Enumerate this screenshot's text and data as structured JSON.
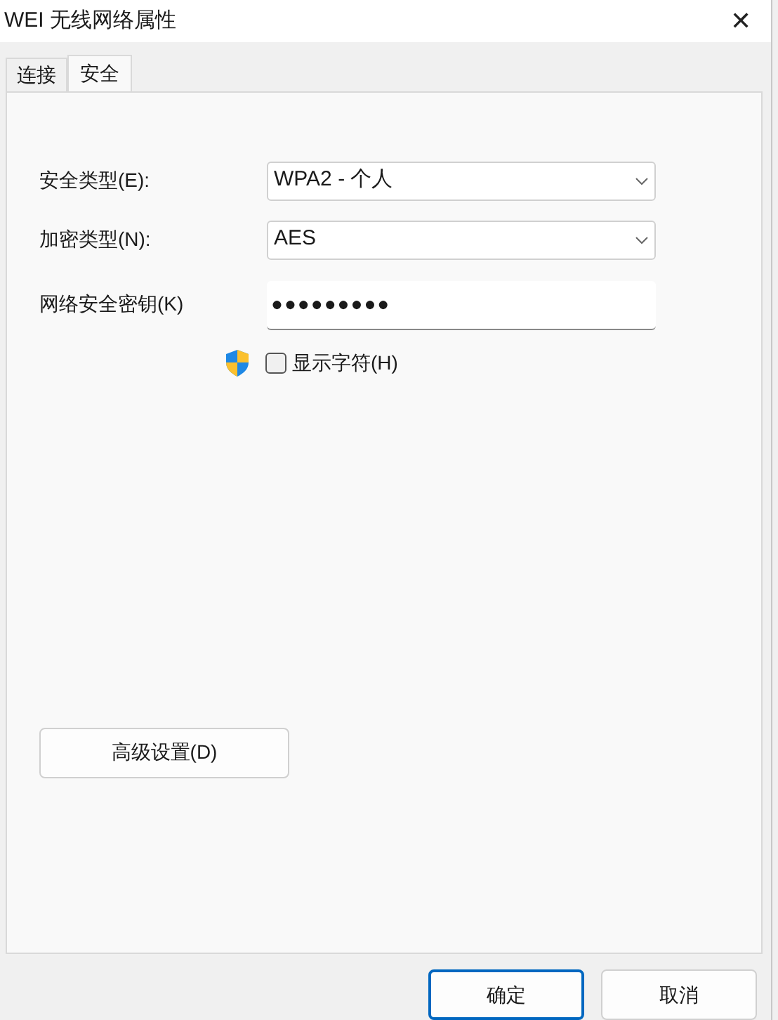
{
  "window": {
    "title": "WEI 无线网络属性",
    "close": "✕"
  },
  "tabs": [
    {
      "label": "连接",
      "selected": false
    },
    {
      "label": "安全",
      "selected": true
    }
  ],
  "security_type": {
    "label": "安全类型(E):",
    "value": "WPA2 - 个人"
  },
  "encryption_type": {
    "label": "加密类型(N):",
    "value": "AES"
  },
  "network_key": {
    "label": "网络安全密钥(K)",
    "value": "●●●●●●●●●"
  },
  "show_characters": {
    "label": "显示字符(H)",
    "checked": false
  },
  "advanced_button": "高级设置(D)",
  "buttons": [
    {
      "label": "确定",
      "default": true
    },
    {
      "label": "取消",
      "default": false
    }
  ]
}
